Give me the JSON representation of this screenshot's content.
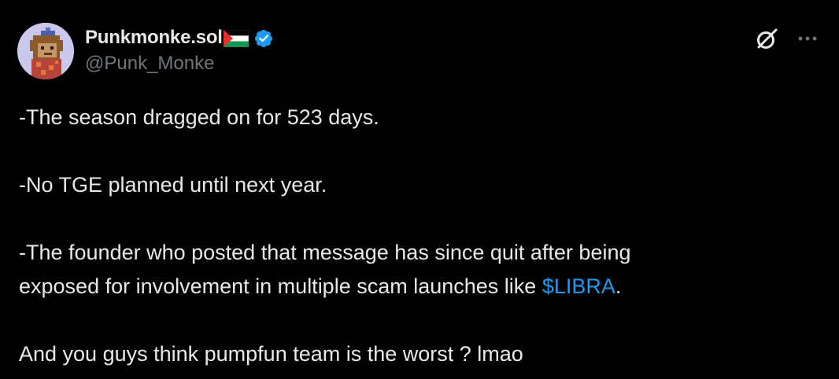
{
  "author": {
    "display_name": "Punkmonke.sol",
    "flag_icon": "palestine-flag-icon",
    "verified_icon": "verified-badge-icon",
    "handle": "@Punk_Monke",
    "avatar_icon": "pixel-monkey-avatar"
  },
  "header_actions": {
    "grok_icon": "grok-icon",
    "more_icon": "more-icon"
  },
  "tweet": {
    "line1": "-The season dragged on for 523 days.",
    "line2": "-No TGE planned until next year.",
    "line3a": "-The founder who posted that message has since quit after being",
    "line3b_pre": "exposed for involvement in multiple scam launches like ",
    "cashtag": "$LIBRA",
    "line3b_post": ".",
    "line4": "And you guys think pumpfun team is the worst ? lmao"
  },
  "colors": {
    "background": "#000000",
    "text": "#e7e9ea",
    "secondary": "#71767b",
    "link": "#1d9bf0"
  }
}
